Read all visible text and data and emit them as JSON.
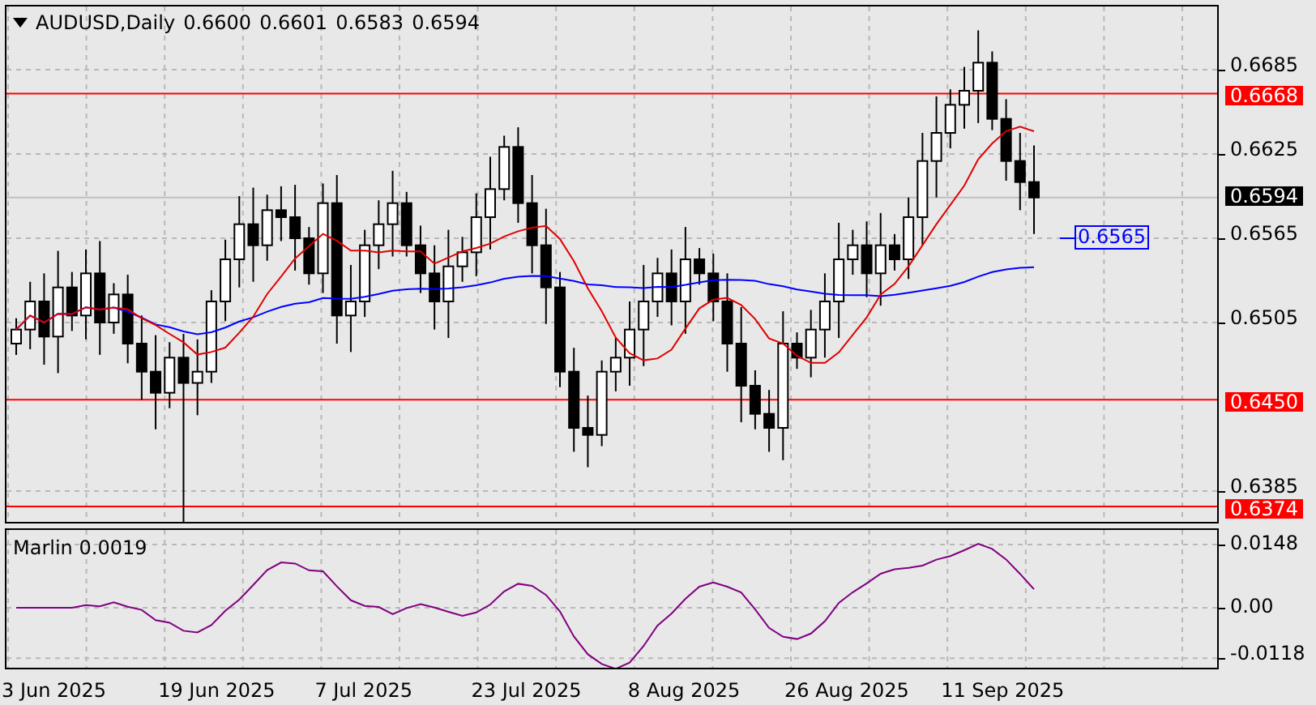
{
  "header": {
    "symbol": "AUDUSD,Daily",
    "ohlc": [
      "0.6600",
      "0.6601",
      "0.6583",
      "0.6594"
    ]
  },
  "price_axis": {
    "ticks": [
      "0.6685",
      "0.6625",
      "0.6565",
      "0.6505",
      "0.6385"
    ]
  },
  "levels": [
    {
      "price": "0.6668",
      "kind": "horizontal"
    },
    {
      "price": "0.6450",
      "kind": "horizontal"
    },
    {
      "price": "0.6374",
      "kind": "horizontal"
    }
  ],
  "current_price": "0.6594",
  "moving_average_label": "0.6565",
  "indicator": {
    "name": "Marlin",
    "value": "0.0019",
    "ticks": [
      "0.0148",
      "0.00",
      "-0.0118"
    ]
  },
  "dates": [
    "3 Jun 2025",
    "19 Jun 2025",
    "7 Jul 2025",
    "23 Jul 2025",
    "8 Aug 2025",
    "26 Aug 2025",
    "11 Sep 2025"
  ]
}
